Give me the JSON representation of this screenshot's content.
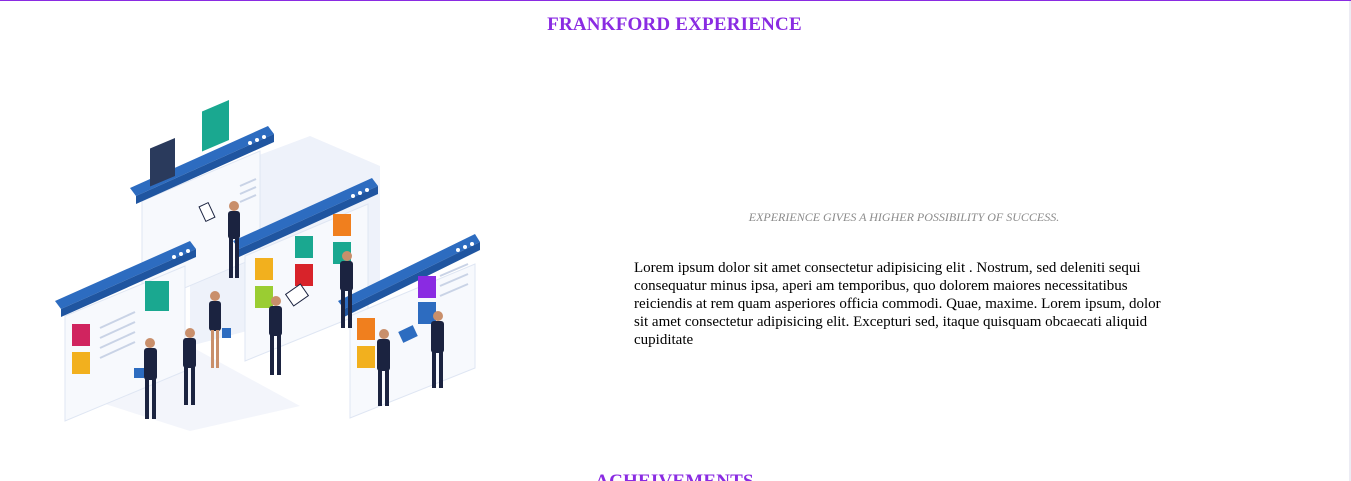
{
  "header": {
    "title": "FRANKFORD EXPERIENCE"
  },
  "content": {
    "tagline": "EXPERIENCE GIVES A HIGHER POSSIBILITY OF SUCCESS.",
    "paragraph": "Lorem ipsum dolor sit amet consectetur adipisicing elit . Nostrum, sed deleniti sequi consequatur minus ipsa, aperi am temporibus, quo dolorem maiores necessitatibus reiciendis at rem quam asperiores officia commodi. Quae, maxime. Lorem ipsum, dolor sit amet consectetur adipisicing elit. Excepturi sed, itaque quisquam obcaecati aliquid cupiditate"
  },
  "next_section": {
    "title": "ACHEIVEMENTS"
  },
  "colors": {
    "accent": "#8a2be2",
    "panel_blue": "#2d6cc0",
    "suit_navy": "#1b2340",
    "tagline_gray": "#8b8b8b"
  },
  "illustration": {
    "icon": "business-people-profiles-illustration"
  }
}
